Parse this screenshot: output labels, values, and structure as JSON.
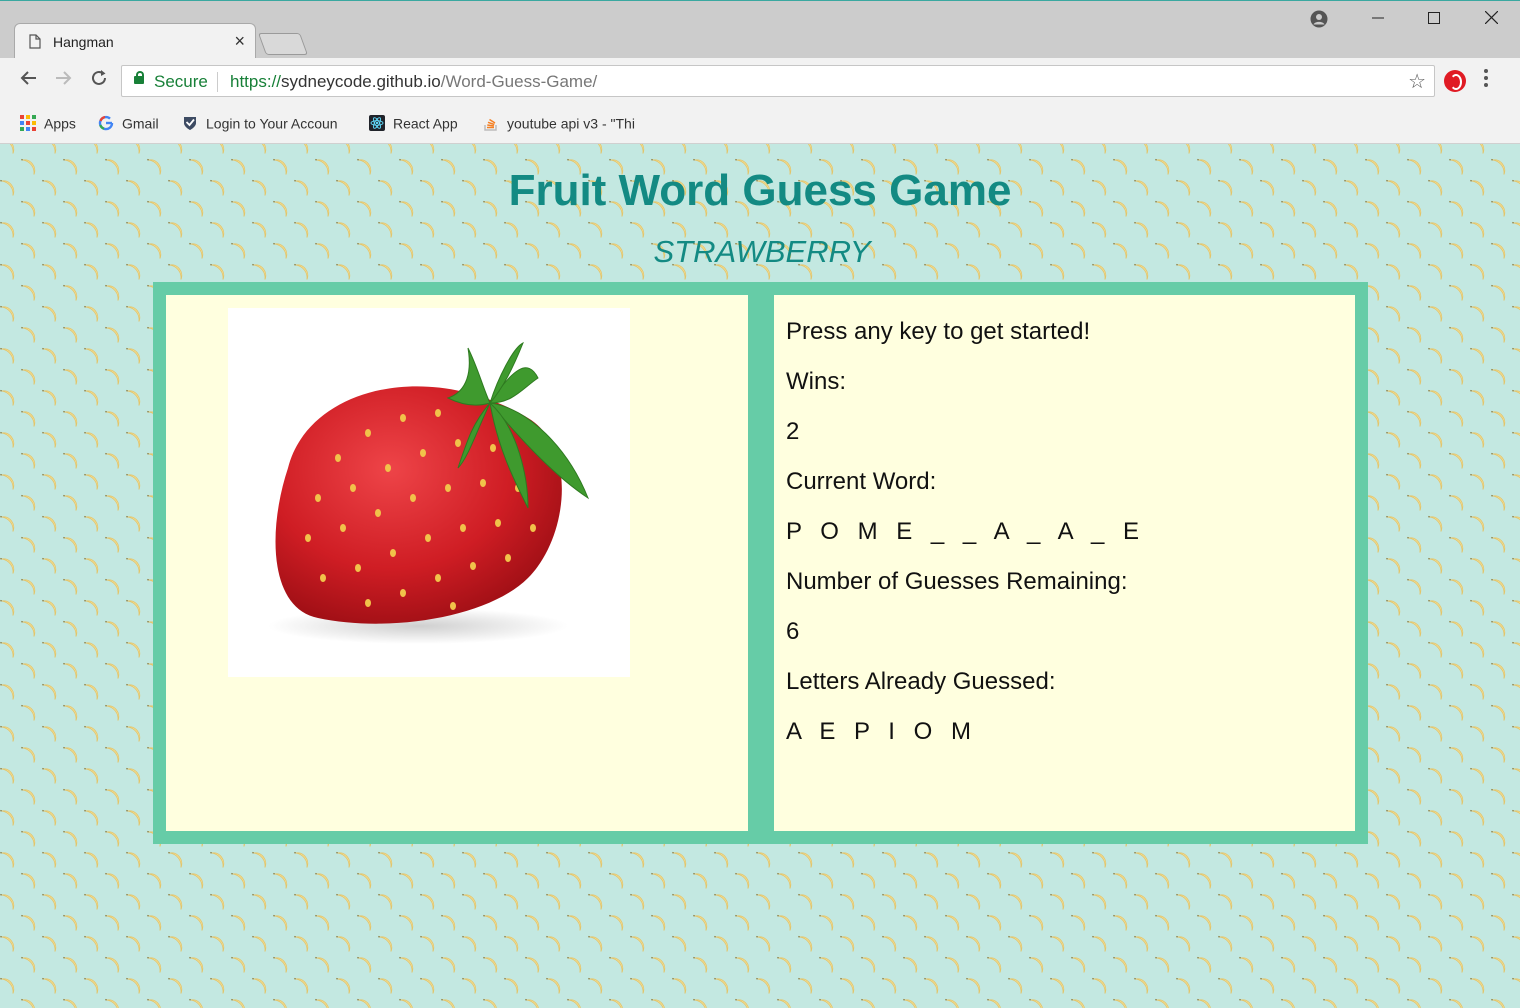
{
  "browser": {
    "tab_title": "Hangman",
    "secure_label": "Secure",
    "url": {
      "scheme": "https://",
      "host": "sydneycode.github.io",
      "path": "/Word-Guess-Game/"
    },
    "bookmarks": [
      {
        "label": "Apps",
        "icon": "apps-grid-icon"
      },
      {
        "label": "Gmail",
        "icon": "google-icon"
      },
      {
        "label": "Login to Your Accoun",
        "icon": "shield-check-icon"
      },
      {
        "label": "React App",
        "icon": "react-icon"
      },
      {
        "label": "youtube api v3 - \"Thi",
        "icon": "stack-overflow-icon"
      }
    ]
  },
  "game": {
    "title": "Fruit Word Guess Game",
    "fruit_name": "STRAWBERRY",
    "prompt": "Press any key to get started!",
    "wins_label": "Wins:",
    "wins": "2",
    "current_word_label": "Current Word:",
    "current_word": "P O M E _ _ A _ A _ E",
    "guesses_remaining_label": "Number of Guesses Remaining:",
    "guesses_remaining": "6",
    "letters_guessed_label": "Letters Already Guessed:",
    "letters_guessed": "A E P I O M"
  },
  "colors": {
    "title": "#138a83",
    "page_background": "#c3e8e1",
    "frame": "#66cca7",
    "panel": "#ffffdf"
  }
}
